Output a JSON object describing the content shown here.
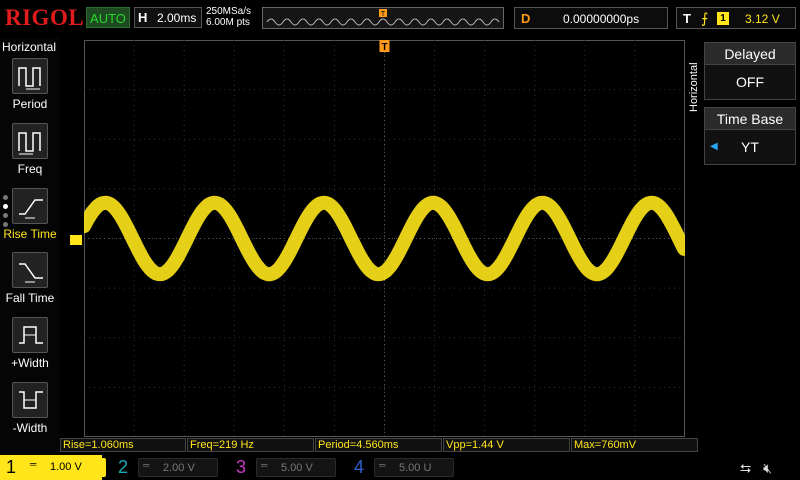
{
  "brand": {
    "logo": "RIGOL",
    "run_mode": "AUTO"
  },
  "horizontal": {
    "key": "H",
    "timebase": "2.00ms",
    "sample_rate": "250MSa/s",
    "memory_depth": "6.00M pts"
  },
  "delay": {
    "key": "D",
    "value": "0.00000000ps"
  },
  "trigger": {
    "key": "T",
    "source": "1",
    "level": "3.12 V"
  },
  "left_menu": {
    "title": "Horizontal",
    "items": [
      {
        "label": "Period",
        "icon": "period-icon"
      },
      {
        "label": "Freq",
        "icon": "freq-icon"
      },
      {
        "label": "Rise Time",
        "icon": "rise-time-icon"
      },
      {
        "label": "Fall Time",
        "icon": "fall-time-icon"
      },
      {
        "label": "+Width",
        "icon": "pos-width-icon"
      },
      {
        "label": "-Width",
        "icon": "neg-width-icon"
      }
    ]
  },
  "right_panel": {
    "vertical_label": "Horizontal",
    "delayed": {
      "label": "Delayed",
      "value": "OFF"
    },
    "time_base": {
      "label": "Time Base",
      "value": "YT"
    }
  },
  "measurements": [
    "Rise=1.060ms",
    "Freq=219 Hz",
    "Period=4.560ms",
    "Vpp=1.44 V",
    "Max=760mV"
  ],
  "channels": [
    {
      "num": "1",
      "scale": "1.00 V",
      "color": "#ffe51a",
      "active": true
    },
    {
      "num": "2",
      "scale": "2.00 V",
      "color": "#1aa8b8",
      "active": false
    },
    {
      "num": "3",
      "scale": "5.00 V",
      "color": "#c23cc2",
      "active": false
    },
    {
      "num": "4",
      "scale": "5.00 U",
      "color": "#2e5fcc",
      "active": false
    }
  ],
  "waveform": {
    "channel": "1",
    "cycles_on_screen": 5.5,
    "color": "#ffe51a",
    "amplitude_div": 0.72
  },
  "colors": {
    "ch1": "#ffe51a",
    "brand": "#e11c1c",
    "auto": "#25d82a",
    "delay": "#ff9a1a",
    "trigger": "#ff9a1a"
  }
}
